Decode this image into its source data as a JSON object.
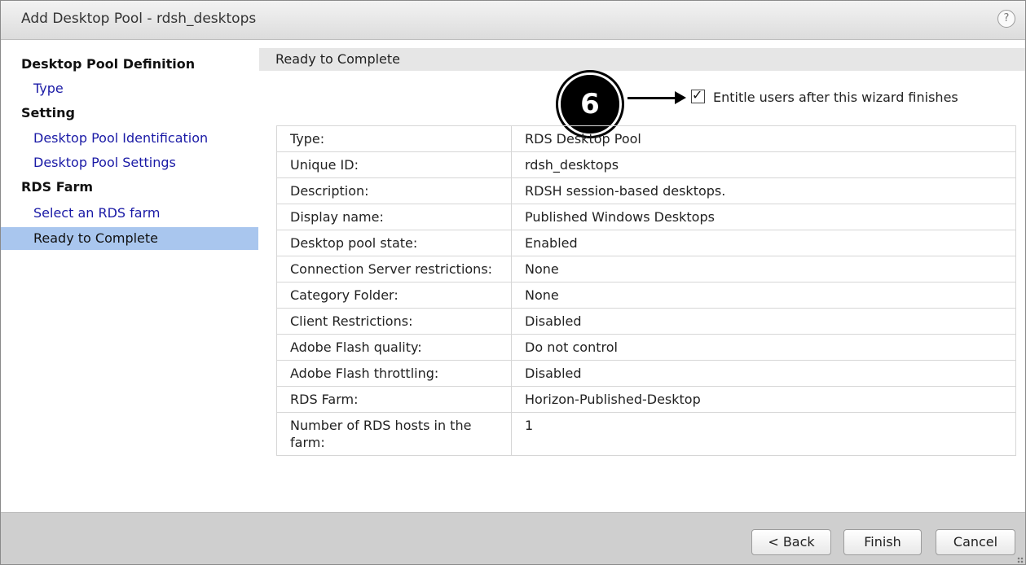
{
  "window": {
    "title": "Add Desktop Pool - rdsh_desktops",
    "help_label": "?"
  },
  "sidebar": {
    "items": [
      {
        "label": "Desktop Pool Definition",
        "kind": "header"
      },
      {
        "label": "Type",
        "kind": "link"
      },
      {
        "label": "Setting",
        "kind": "header"
      },
      {
        "label": "Desktop Pool Identification",
        "kind": "link"
      },
      {
        "label": "Desktop Pool Settings",
        "kind": "link"
      },
      {
        "label": "RDS Farm",
        "kind": "header"
      },
      {
        "label": "Select an RDS farm",
        "kind": "link"
      },
      {
        "label": "Ready to Complete",
        "kind": "current"
      }
    ]
  },
  "main": {
    "section_title": "Ready to Complete",
    "annotation": {
      "number": "6"
    },
    "entitle": {
      "label": "Entitle users after this wizard finishes",
      "checked": true
    },
    "rows": [
      {
        "key": "Type:",
        "value": "RDS Desktop Pool"
      },
      {
        "key": "Unique ID:",
        "value": "rdsh_desktops"
      },
      {
        "key": "Description:",
        "value": "RDSH session-based desktops."
      },
      {
        "key": "Display name:",
        "value": "Published Windows Desktops"
      },
      {
        "key": "Desktop pool state:",
        "value": "Enabled"
      },
      {
        "key": "Connection Server restrictions:",
        "value": "None"
      },
      {
        "key": "Category Folder:",
        "value": "None"
      },
      {
        "key": "Client Restrictions:",
        "value": "Disabled"
      },
      {
        "key": "Adobe Flash quality:",
        "value": "Do not control"
      },
      {
        "key": "Adobe Flash throttling:",
        "value": "Disabled"
      },
      {
        "key": "RDS Farm:",
        "value": "Horizon-Published-Desktop"
      },
      {
        "key": "Number of RDS hosts in the farm:",
        "value": "1"
      }
    ]
  },
  "footer": {
    "back_label": "< Back",
    "finish_label": "Finish",
    "cancel_label": "Cancel"
  },
  "colors": {
    "selected_nav": "#a9c6ee",
    "link": "#1a1aa6",
    "footer_bg": "#cfcfcf"
  }
}
